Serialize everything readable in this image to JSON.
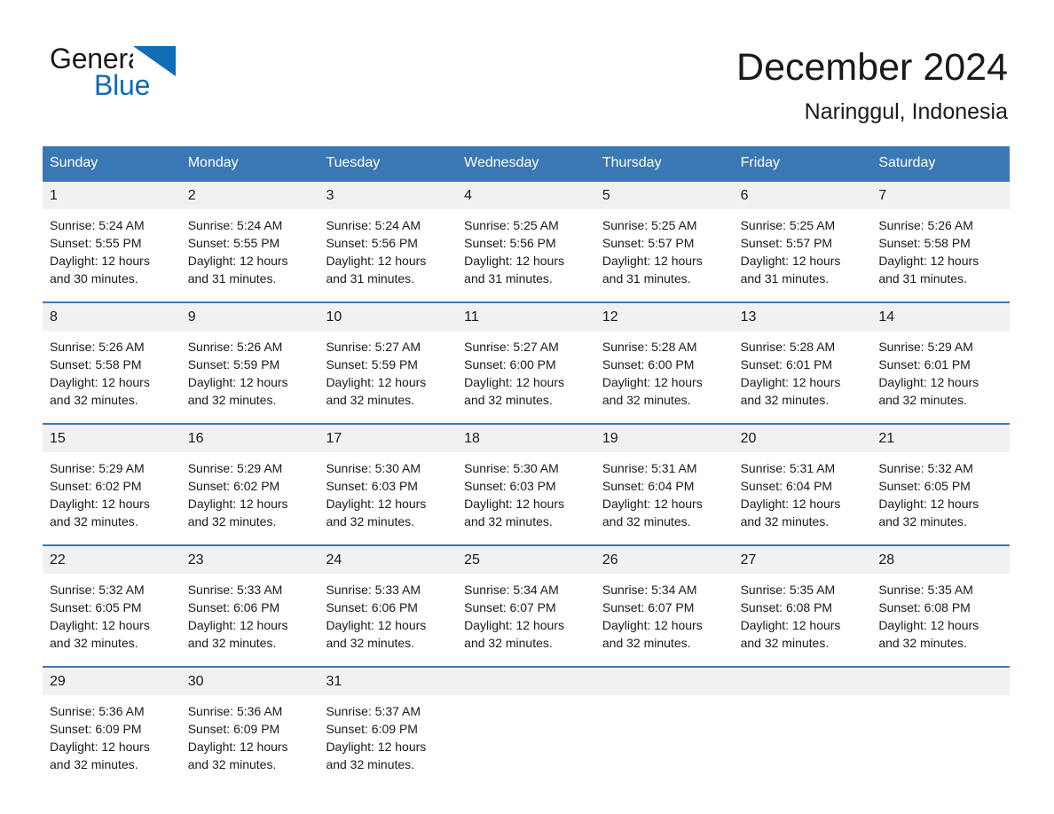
{
  "brand": {
    "name_part1": "General",
    "name_part2": "Blue",
    "accent_color": "#0f6cb5"
  },
  "header": {
    "title": "December 2024",
    "subtitle": "Naringgul, Indonesia"
  },
  "calendar": {
    "header_bg": "#3a78b5",
    "daynum_bg": "#f1f1f1",
    "weekdays": [
      "Sunday",
      "Monday",
      "Tuesday",
      "Wednesday",
      "Thursday",
      "Friday",
      "Saturday"
    ],
    "weeks": [
      [
        {
          "day": "1",
          "sunrise": "Sunrise: 5:24 AM",
          "sunset": "Sunset: 5:55 PM",
          "daylight_line1": "Daylight: 12 hours",
          "daylight_line2": "and 30 minutes."
        },
        {
          "day": "2",
          "sunrise": "Sunrise: 5:24 AM",
          "sunset": "Sunset: 5:55 PM",
          "daylight_line1": "Daylight: 12 hours",
          "daylight_line2": "and 31 minutes."
        },
        {
          "day": "3",
          "sunrise": "Sunrise: 5:24 AM",
          "sunset": "Sunset: 5:56 PM",
          "daylight_line1": "Daylight: 12 hours",
          "daylight_line2": "and 31 minutes."
        },
        {
          "day": "4",
          "sunrise": "Sunrise: 5:25 AM",
          "sunset": "Sunset: 5:56 PM",
          "daylight_line1": "Daylight: 12 hours",
          "daylight_line2": "and 31 minutes."
        },
        {
          "day": "5",
          "sunrise": "Sunrise: 5:25 AM",
          "sunset": "Sunset: 5:57 PM",
          "daylight_line1": "Daylight: 12 hours",
          "daylight_line2": "and 31 minutes."
        },
        {
          "day": "6",
          "sunrise": "Sunrise: 5:25 AM",
          "sunset": "Sunset: 5:57 PM",
          "daylight_line1": "Daylight: 12 hours",
          "daylight_line2": "and 31 minutes."
        },
        {
          "day": "7",
          "sunrise": "Sunrise: 5:26 AM",
          "sunset": "Sunset: 5:58 PM",
          "daylight_line1": "Daylight: 12 hours",
          "daylight_line2": "and 31 minutes."
        }
      ],
      [
        {
          "day": "8",
          "sunrise": "Sunrise: 5:26 AM",
          "sunset": "Sunset: 5:58 PM",
          "daylight_line1": "Daylight: 12 hours",
          "daylight_line2": "and 32 minutes."
        },
        {
          "day": "9",
          "sunrise": "Sunrise: 5:26 AM",
          "sunset": "Sunset: 5:59 PM",
          "daylight_line1": "Daylight: 12 hours",
          "daylight_line2": "and 32 minutes."
        },
        {
          "day": "10",
          "sunrise": "Sunrise: 5:27 AM",
          "sunset": "Sunset: 5:59 PM",
          "daylight_line1": "Daylight: 12 hours",
          "daylight_line2": "and 32 minutes."
        },
        {
          "day": "11",
          "sunrise": "Sunrise: 5:27 AM",
          "sunset": "Sunset: 6:00 PM",
          "daylight_line1": "Daylight: 12 hours",
          "daylight_line2": "and 32 minutes."
        },
        {
          "day": "12",
          "sunrise": "Sunrise: 5:28 AM",
          "sunset": "Sunset: 6:00 PM",
          "daylight_line1": "Daylight: 12 hours",
          "daylight_line2": "and 32 minutes."
        },
        {
          "day": "13",
          "sunrise": "Sunrise: 5:28 AM",
          "sunset": "Sunset: 6:01 PM",
          "daylight_line1": "Daylight: 12 hours",
          "daylight_line2": "and 32 minutes."
        },
        {
          "day": "14",
          "sunrise": "Sunrise: 5:29 AM",
          "sunset": "Sunset: 6:01 PM",
          "daylight_line1": "Daylight: 12 hours",
          "daylight_line2": "and 32 minutes."
        }
      ],
      [
        {
          "day": "15",
          "sunrise": "Sunrise: 5:29 AM",
          "sunset": "Sunset: 6:02 PM",
          "daylight_line1": "Daylight: 12 hours",
          "daylight_line2": "and 32 minutes."
        },
        {
          "day": "16",
          "sunrise": "Sunrise: 5:29 AM",
          "sunset": "Sunset: 6:02 PM",
          "daylight_line1": "Daylight: 12 hours",
          "daylight_line2": "and 32 minutes."
        },
        {
          "day": "17",
          "sunrise": "Sunrise: 5:30 AM",
          "sunset": "Sunset: 6:03 PM",
          "daylight_line1": "Daylight: 12 hours",
          "daylight_line2": "and 32 minutes."
        },
        {
          "day": "18",
          "sunrise": "Sunrise: 5:30 AM",
          "sunset": "Sunset: 6:03 PM",
          "daylight_line1": "Daylight: 12 hours",
          "daylight_line2": "and 32 minutes."
        },
        {
          "day": "19",
          "sunrise": "Sunrise: 5:31 AM",
          "sunset": "Sunset: 6:04 PM",
          "daylight_line1": "Daylight: 12 hours",
          "daylight_line2": "and 32 minutes."
        },
        {
          "day": "20",
          "sunrise": "Sunrise: 5:31 AM",
          "sunset": "Sunset: 6:04 PM",
          "daylight_line1": "Daylight: 12 hours",
          "daylight_line2": "and 32 minutes."
        },
        {
          "day": "21",
          "sunrise": "Sunrise: 5:32 AM",
          "sunset": "Sunset: 6:05 PM",
          "daylight_line1": "Daylight: 12 hours",
          "daylight_line2": "and 32 minutes."
        }
      ],
      [
        {
          "day": "22",
          "sunrise": "Sunrise: 5:32 AM",
          "sunset": "Sunset: 6:05 PM",
          "daylight_line1": "Daylight: 12 hours",
          "daylight_line2": "and 32 minutes."
        },
        {
          "day": "23",
          "sunrise": "Sunrise: 5:33 AM",
          "sunset": "Sunset: 6:06 PM",
          "daylight_line1": "Daylight: 12 hours",
          "daylight_line2": "and 32 minutes."
        },
        {
          "day": "24",
          "sunrise": "Sunrise: 5:33 AM",
          "sunset": "Sunset: 6:06 PM",
          "daylight_line1": "Daylight: 12 hours",
          "daylight_line2": "and 32 minutes."
        },
        {
          "day": "25",
          "sunrise": "Sunrise: 5:34 AM",
          "sunset": "Sunset: 6:07 PM",
          "daylight_line1": "Daylight: 12 hours",
          "daylight_line2": "and 32 minutes."
        },
        {
          "day": "26",
          "sunrise": "Sunrise: 5:34 AM",
          "sunset": "Sunset: 6:07 PM",
          "daylight_line1": "Daylight: 12 hours",
          "daylight_line2": "and 32 minutes."
        },
        {
          "day": "27",
          "sunrise": "Sunrise: 5:35 AM",
          "sunset": "Sunset: 6:08 PM",
          "daylight_line1": "Daylight: 12 hours",
          "daylight_line2": "and 32 minutes."
        },
        {
          "day": "28",
          "sunrise": "Sunrise: 5:35 AM",
          "sunset": "Sunset: 6:08 PM",
          "daylight_line1": "Daylight: 12 hours",
          "daylight_line2": "and 32 minutes."
        }
      ],
      [
        {
          "day": "29",
          "sunrise": "Sunrise: 5:36 AM",
          "sunset": "Sunset: 6:09 PM",
          "daylight_line1": "Daylight: 12 hours",
          "daylight_line2": "and 32 minutes."
        },
        {
          "day": "30",
          "sunrise": "Sunrise: 5:36 AM",
          "sunset": "Sunset: 6:09 PM",
          "daylight_line1": "Daylight: 12 hours",
          "daylight_line2": "and 32 minutes."
        },
        {
          "day": "31",
          "sunrise": "Sunrise: 5:37 AM",
          "sunset": "Sunset: 6:09 PM",
          "daylight_line1": "Daylight: 12 hours",
          "daylight_line2": "and 32 minutes."
        },
        {
          "day": "",
          "sunrise": "",
          "sunset": "",
          "daylight_line1": "",
          "daylight_line2": ""
        },
        {
          "day": "",
          "sunrise": "",
          "sunset": "",
          "daylight_line1": "",
          "daylight_line2": ""
        },
        {
          "day": "",
          "sunrise": "",
          "sunset": "",
          "daylight_line1": "",
          "daylight_line2": ""
        },
        {
          "day": "",
          "sunrise": "",
          "sunset": "",
          "daylight_line1": "",
          "daylight_line2": ""
        }
      ]
    ]
  }
}
